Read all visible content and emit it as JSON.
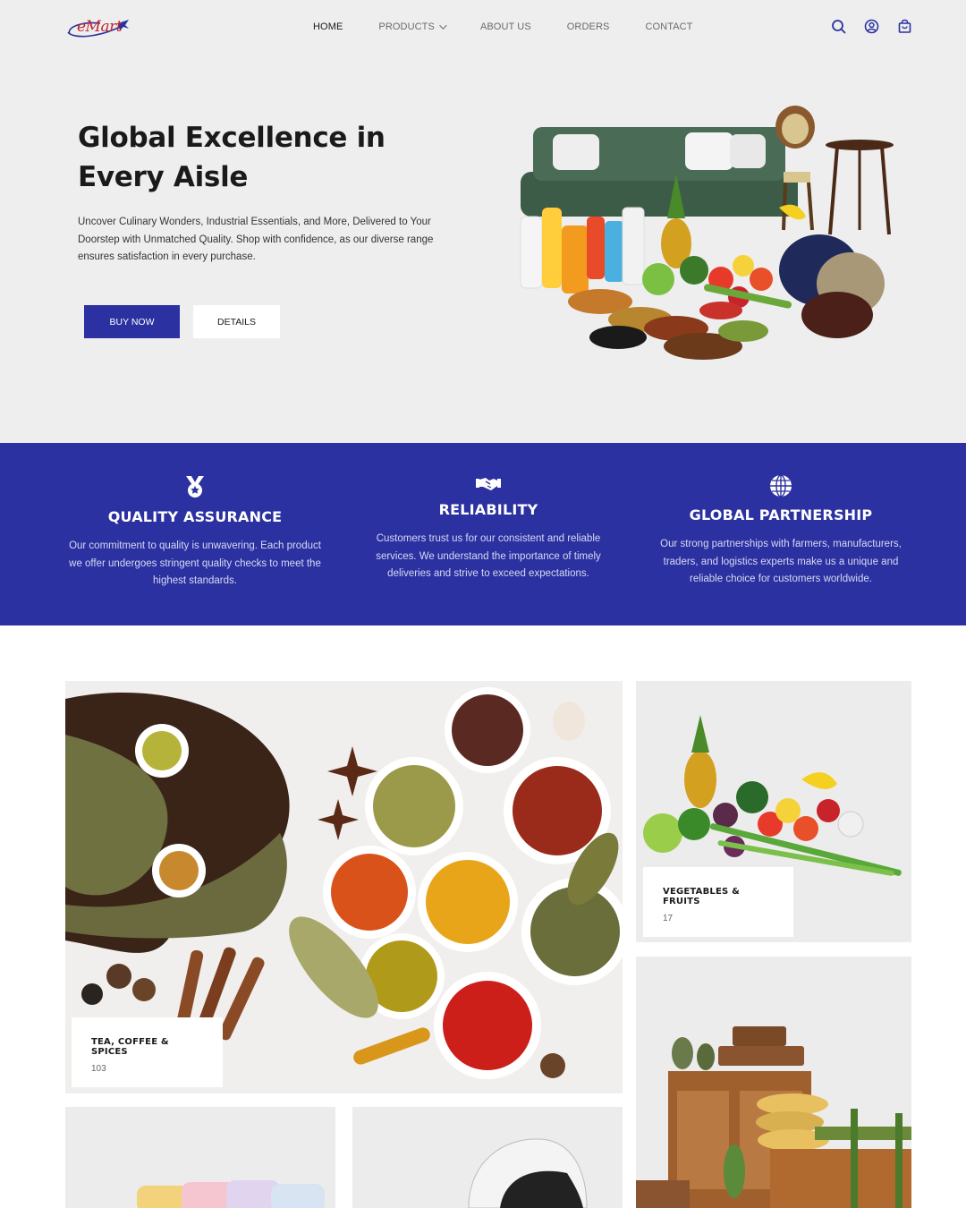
{
  "brand": {
    "logo_text": "eMart"
  },
  "nav": {
    "items": [
      {
        "label": "HOME",
        "active": true
      },
      {
        "label": "PRODUCTS",
        "has_dropdown": true
      },
      {
        "label": "ABOUT US"
      },
      {
        "label": "ORDERS"
      },
      {
        "label": "CONTACT"
      }
    ],
    "icons": [
      "search-icon",
      "user-icon",
      "bag-icon"
    ]
  },
  "hero": {
    "title": "Global Excellence in Every Aisle",
    "description": "Uncover Culinary Wonders, Industrial Essentials, and More, Delivered to Your Doorstep with Unmatched Quality. Shop with confidence, as our diverse range ensures satisfaction in every purchase.",
    "buy_label": "BUY NOW",
    "details_label": "DETAILS"
  },
  "features": [
    {
      "icon": "medal-icon",
      "title": "QUALITY ASSURANCE",
      "text": "Our commitment to quality is unwavering. Each product we offer undergoes stringent quality checks to meet the highest standards."
    },
    {
      "icon": "handshake-icon",
      "title": "RELIABILITY",
      "text": "Customers trust us for our consistent and reliable services. We understand the importance of timely deliveries and strive to exceed expectations."
    },
    {
      "icon": "globe-icon",
      "title": "GLOBAL PARTNERSHIP",
      "text": "Our strong partnerships with farmers, manufacturers, traders, and logistics experts make us a unique and reliable choice for customers worldwide."
    }
  ],
  "categories": [
    {
      "name": "TEA, COFFEE & SPICES",
      "count": "103"
    },
    {
      "name": "VEGETABLES & FRUITS",
      "count": "17"
    }
  ],
  "colors": {
    "brand_blue": "#2b31a0",
    "logo_red": "#c0262d",
    "page_grey": "#eeeeee"
  }
}
